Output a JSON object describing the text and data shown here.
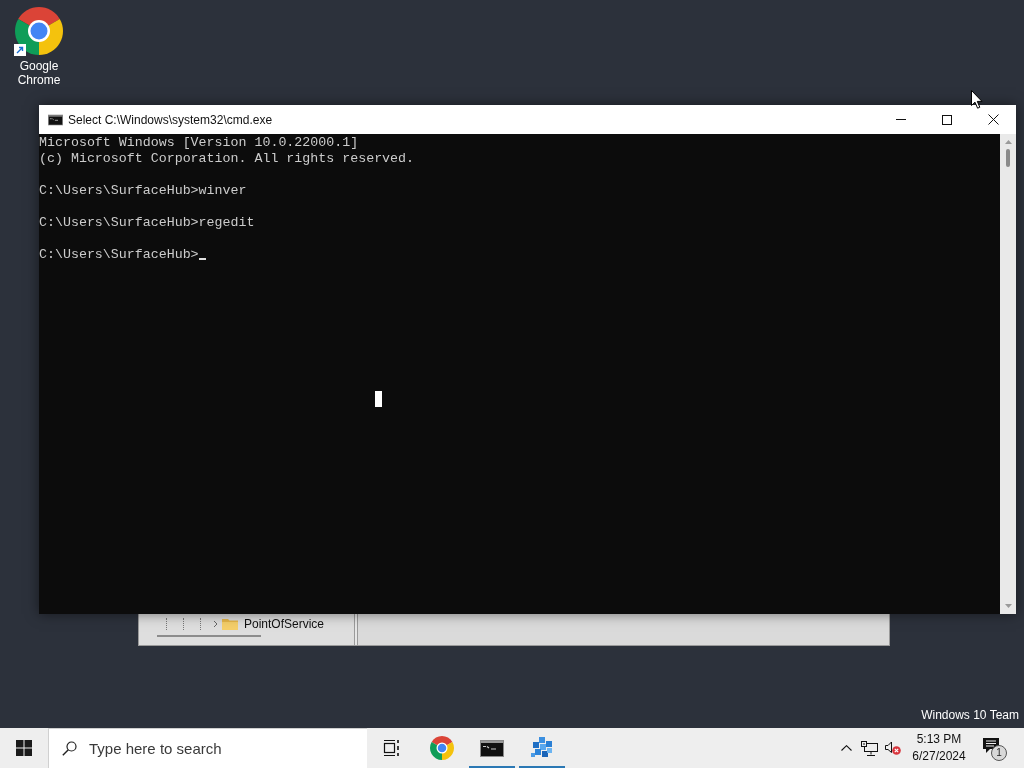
{
  "desktop": {
    "shortcuts": [
      {
        "label": "Google Chrome"
      }
    ],
    "edition_text": "Windows 10 Team"
  },
  "background_window": {
    "tree_items": [
      {
        "label": "PointOfService"
      }
    ]
  },
  "console_window": {
    "title": "Select C:\\Windows\\system32\\cmd.exe",
    "blocks": [
      {
        "lines": [
          "Microsoft Windows [Version 10.0.22000.1]",
          "(c) Microsoft Corporation. All rights reserved."
        ]
      },
      {
        "lines": [
          "C:\\Users\\SurfaceHub>winver"
        ]
      },
      {
        "lines": [
          "C:\\Users\\SurfaceHub>regedit"
        ]
      },
      {
        "lines": [
          "C:\\Users\\SurfaceHub>"
        ]
      }
    ],
    "cursor": true
  },
  "taskbar": {
    "search": {
      "placeholder": "Type here to search"
    },
    "apps": [
      {
        "kind": "chrome",
        "running": false
      },
      {
        "kind": "console",
        "running": true
      },
      {
        "kind": "registry",
        "running": true
      }
    ],
    "tray": {
      "volume_muted": true,
      "time": "5:13 PM",
      "date": "6/27/2024",
      "notification_count": "1"
    }
  }
}
